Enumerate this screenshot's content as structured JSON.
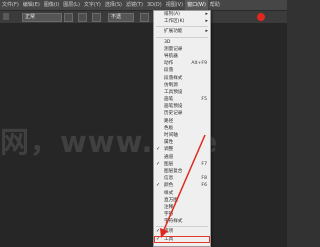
{
  "menubar": {
    "items": [
      "文件(F)",
      "编辑(E)",
      "图像(I)",
      "图层(L)",
      "文字(Y)",
      "选择(S)",
      "滤镜(T)",
      "3D(D)",
      "视图(V)",
      "窗口(W)",
      "帮助"
    ]
  },
  "options": {
    "mode": "正常",
    "size": "不透"
  },
  "watermark": "网，www.itse",
  "window_menu": {
    "items": [
      {
        "label": "排列(A)",
        "submenu": true
      },
      {
        "label": "工作区(K)",
        "submenu": true
      },
      {
        "sep": true
      },
      {
        "label": "扩展功能",
        "submenu": true
      },
      {
        "sep": true
      },
      {
        "label": "3D"
      },
      {
        "label": "测量记录"
      },
      {
        "label": "导航器"
      },
      {
        "label": "动作",
        "shortcut": "Alt+F9"
      },
      {
        "label": "段落"
      },
      {
        "label": "段落样式"
      },
      {
        "label": "仿制源"
      },
      {
        "label": "工具预设"
      },
      {
        "label": "画笔",
        "shortcut": "F5"
      },
      {
        "label": "画笔预设"
      },
      {
        "label": "历史记录"
      },
      {
        "label": "路径"
      },
      {
        "label": "色板"
      },
      {
        "label": "时间轴"
      },
      {
        "label": "属性"
      },
      {
        "label": "调整",
        "checked": true
      },
      {
        "label": "通道"
      },
      {
        "label": "图层",
        "shortcut": "F7",
        "checked": true
      },
      {
        "label": "图层复合"
      },
      {
        "label": "信息",
        "shortcut": "F8"
      },
      {
        "label": "颜色",
        "shortcut": "F6",
        "checked": true
      },
      {
        "label": "样式"
      },
      {
        "label": "直方图"
      },
      {
        "label": "注释"
      },
      {
        "label": "字符"
      },
      {
        "label": "字符样式"
      },
      {
        "sep": true
      },
      {
        "label": "选项",
        "checked": true
      },
      {
        "label": "工具",
        "checked": true,
        "highlight": true
      }
    ]
  },
  "colors": {
    "accent": "#e0281f"
  }
}
